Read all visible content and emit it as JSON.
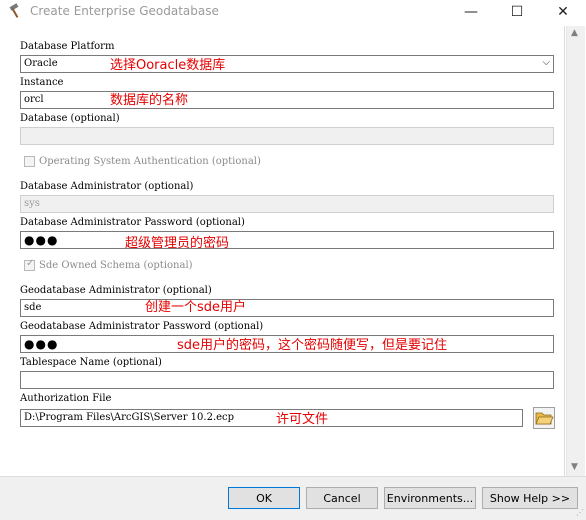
{
  "window": {
    "title": "Create Enterprise Geodatabase",
    "minimize_glyph": "—",
    "maximize_glyph": "☐",
    "close_glyph": "✕",
    "icon": "hammer-icon"
  },
  "form": {
    "database_platform": {
      "label": "Database Platform",
      "value": "Oracle",
      "annotation": "选择Ooracle数据库"
    },
    "instance": {
      "label": "Instance",
      "value": "orcl",
      "annotation": "数据库的名称"
    },
    "database": {
      "label": "Database (optional)",
      "value": ""
    },
    "os_auth": {
      "label": "Operating System Authentication (optional)",
      "checked": false
    },
    "db_admin": {
      "label": "Database Administrator (optional)",
      "value": "sys"
    },
    "db_admin_password": {
      "label": "Database Administrator Password (optional)",
      "masked": "●●●",
      "annotation": "超级管理员的密码"
    },
    "sde_schema": {
      "label": "Sde Owned Schema (optional)",
      "checked": true
    },
    "gdb_admin": {
      "label": "Geodatabase Administrator (optional)",
      "value": "sde",
      "annotation": "创建一个sde用户"
    },
    "gdb_admin_password": {
      "label": "Geodatabase Administrator Password (optional)",
      "masked": "●●●",
      "annotation": "sde用户的密码，这个密码随便写，但是要记住"
    },
    "tablespace": {
      "label": "Tablespace Name (optional)",
      "value": ""
    },
    "auth_file": {
      "label": "Authorization File",
      "value": "D:\\Program Files\\ArcGIS\\Server 10.2.ecp",
      "annotation": "许可文件"
    }
  },
  "buttons": {
    "ok": "OK",
    "cancel": "Cancel",
    "environments": "Environments...",
    "show_help": "Show Help >>"
  },
  "colors": {
    "annotation": "#e60000",
    "focus_border": "#0078d7"
  }
}
